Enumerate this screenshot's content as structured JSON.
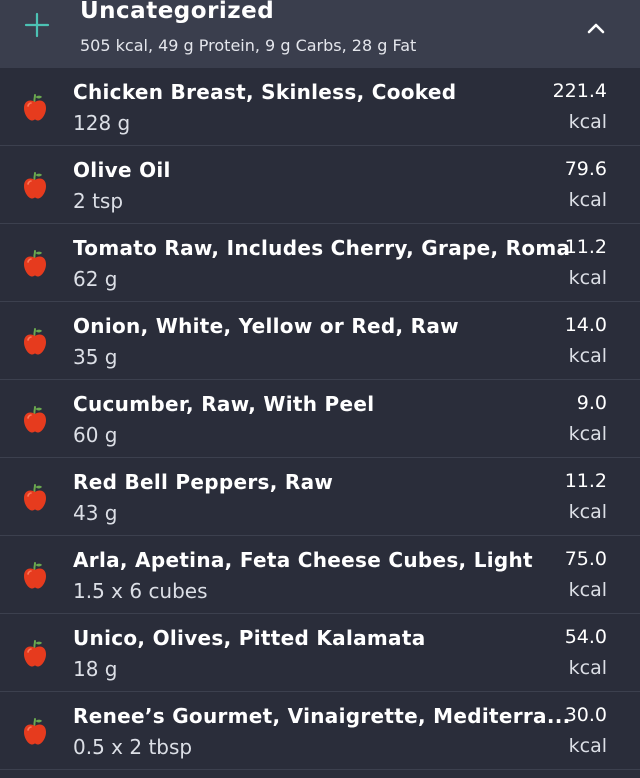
{
  "group": {
    "title": "Uncategorized",
    "summary": "505 kcal, 49 g Protein, 9 g Carbs, 28 g Fat"
  },
  "icons": {
    "add": "plus-icon",
    "collapse": "chevron-up-icon",
    "food": "apple-icon"
  },
  "colors": {
    "accent": "#4cc2b4",
    "apple_red": "#e63b1e",
    "apple_leaf": "#6aa84f"
  },
  "items": [
    {
      "name": "Chicken Breast, Skinless, Cooked",
      "amount": "128 g",
      "kcal": "221.4",
      "unit": "kcal"
    },
    {
      "name": "Olive Oil",
      "amount": "2 tsp",
      "kcal": "79.6",
      "unit": "kcal"
    },
    {
      "name": "Tomato Raw, Includes Cherry, Grape, Roma",
      "amount": "62 g",
      "kcal": "11.2",
      "unit": "kcal"
    },
    {
      "name": "Onion, White, Yellow or Red, Raw",
      "amount": "35 g",
      "kcal": "14.0",
      "unit": "kcal"
    },
    {
      "name": "Cucumber, Raw, With Peel",
      "amount": "60 g",
      "kcal": "9.0",
      "unit": "kcal"
    },
    {
      "name": "Red Bell Peppers, Raw",
      "amount": "43 g",
      "kcal": "11.2",
      "unit": "kcal"
    },
    {
      "name": "Arla, Apetina, Feta Cheese Cubes, Light",
      "amount": "1.5 x 6 cubes",
      "kcal": "75.0",
      "unit": "kcal"
    },
    {
      "name": "Unico, Olives, Pitted Kalamata",
      "amount": "18 g",
      "kcal": "54.0",
      "unit": "kcal"
    },
    {
      "name": "Renee’s Gourmet, Vinaigrette, Mediterra...",
      "amount": "0.5 x 2 tbsp",
      "kcal": "30.0",
      "unit": "kcal"
    }
  ]
}
